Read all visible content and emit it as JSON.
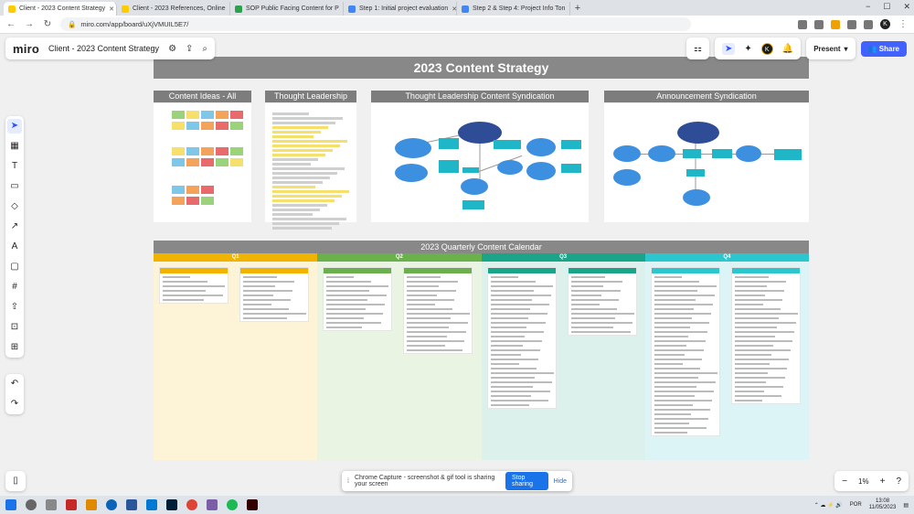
{
  "browser": {
    "tabs": [
      {
        "label": "Client - 2023 Content Strategy",
        "active": true,
        "color": "#ffcc00"
      },
      {
        "label": "Client - 2023 References, Online",
        "active": false,
        "color": "#ffcc00"
      },
      {
        "label": "SOP Public Facing Content for P",
        "active": false,
        "color": "#2e9e4f"
      },
      {
        "label": "Step 1: Initial project evaluation",
        "active": false,
        "color": "#4285f4"
      },
      {
        "label": "Step 2 & Step 4: Project Info Ton",
        "active": false,
        "color": "#4285f4"
      }
    ],
    "new_tab": "+",
    "url": "miro.com/app/board/uXjVMUIL5E7/",
    "profile_initial": "K"
  },
  "miro": {
    "logo": "miro",
    "board_name": "Client - 2023 Content Strategy",
    "present_label": "Present",
    "share_label": "Share",
    "user_initial": "K",
    "zoom": "1%",
    "zoom_minus": "−",
    "zoom_plus": "+"
  },
  "board": {
    "title": "2023 Content Strategy",
    "frames": [
      {
        "title": "Content Ideas - All"
      },
      {
        "title": "Thought Leadership"
      },
      {
        "title": "Thought Leadership Content Syndication"
      },
      {
        "title": "Announcement Syndication"
      }
    ],
    "calendar_title": "2023 Quarterly  Content Calendar",
    "quarters": [
      {
        "label": "Q1",
        "color": "#f0b400",
        "bg": "#fdf3d6"
      },
      {
        "label": "Q2",
        "color": "#6ab04c",
        "bg": "#eaf4e2"
      },
      {
        "label": "Q3",
        "color": "#1aa58a",
        "bg": "#dcf1ec"
      },
      {
        "label": "Q4",
        "color": "#2cc6cf",
        "bg": "#dcf4f6"
      }
    ]
  },
  "capture_bar": {
    "message": "Chrome Capture - screenshot & gif tool is sharing your screen",
    "stop": "Stop sharing",
    "hide": "Hide"
  },
  "taskbar": {
    "lang": "POR",
    "time": "13:08",
    "date": "11/05/2023"
  }
}
